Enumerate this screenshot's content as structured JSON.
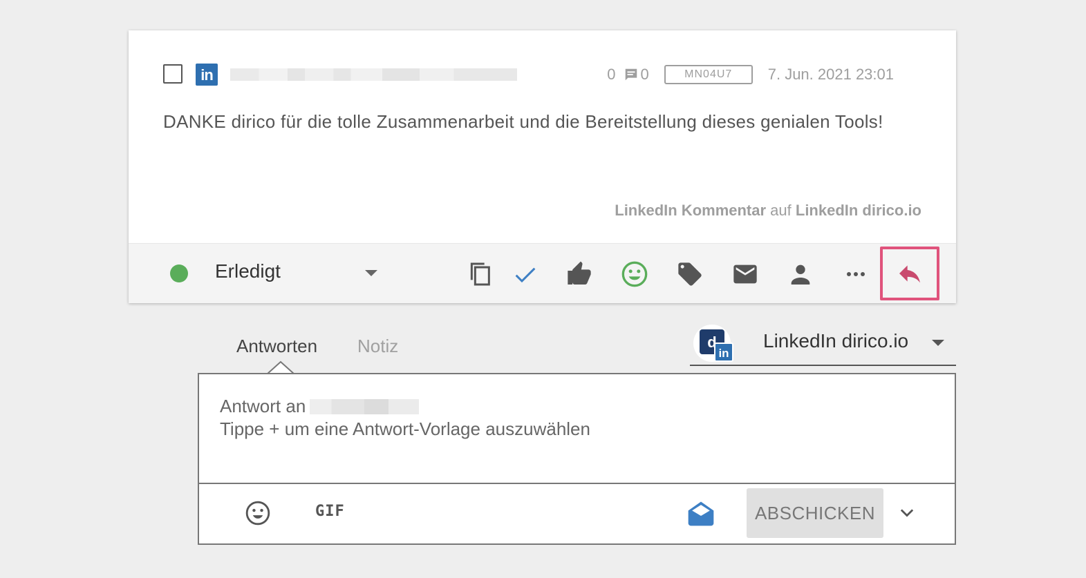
{
  "post": {
    "network_badge": "in",
    "comment_count_a": "0",
    "comment_count_b": "0",
    "code": "MN04U7",
    "date": "7. Jun. 2021 23:01",
    "text": "DANKE dirico für die tolle Zusammenarbeit und die Bereitstellung dieses genialen Tools!",
    "source_type": "LinkedIn Kommentar",
    "source_connector": " auf ",
    "source_account": "LinkedIn dirico.io"
  },
  "toolbar": {
    "status_label": "Erledigt",
    "status_color": "#5aad5a",
    "icons": [
      "copy-icon",
      "check-icon",
      "thumbs-up-icon",
      "smiley-icon",
      "tag-icon",
      "mail-icon",
      "person-icon",
      "more-icon",
      "reply-icon"
    ],
    "reply_highlight_color": "#e0537c"
  },
  "reply": {
    "tabs": [
      "Antworten",
      "Notiz"
    ],
    "account_name": "LinkedIn dirico.io",
    "account_logo": "d",
    "account_badge": "in",
    "recipient_prefix": "Antwort an",
    "hint": "Tippe + um eine Antwort-Vorlage auszuwählen",
    "gif_label": "GIF",
    "send_label": "ABSCHICKEN"
  }
}
